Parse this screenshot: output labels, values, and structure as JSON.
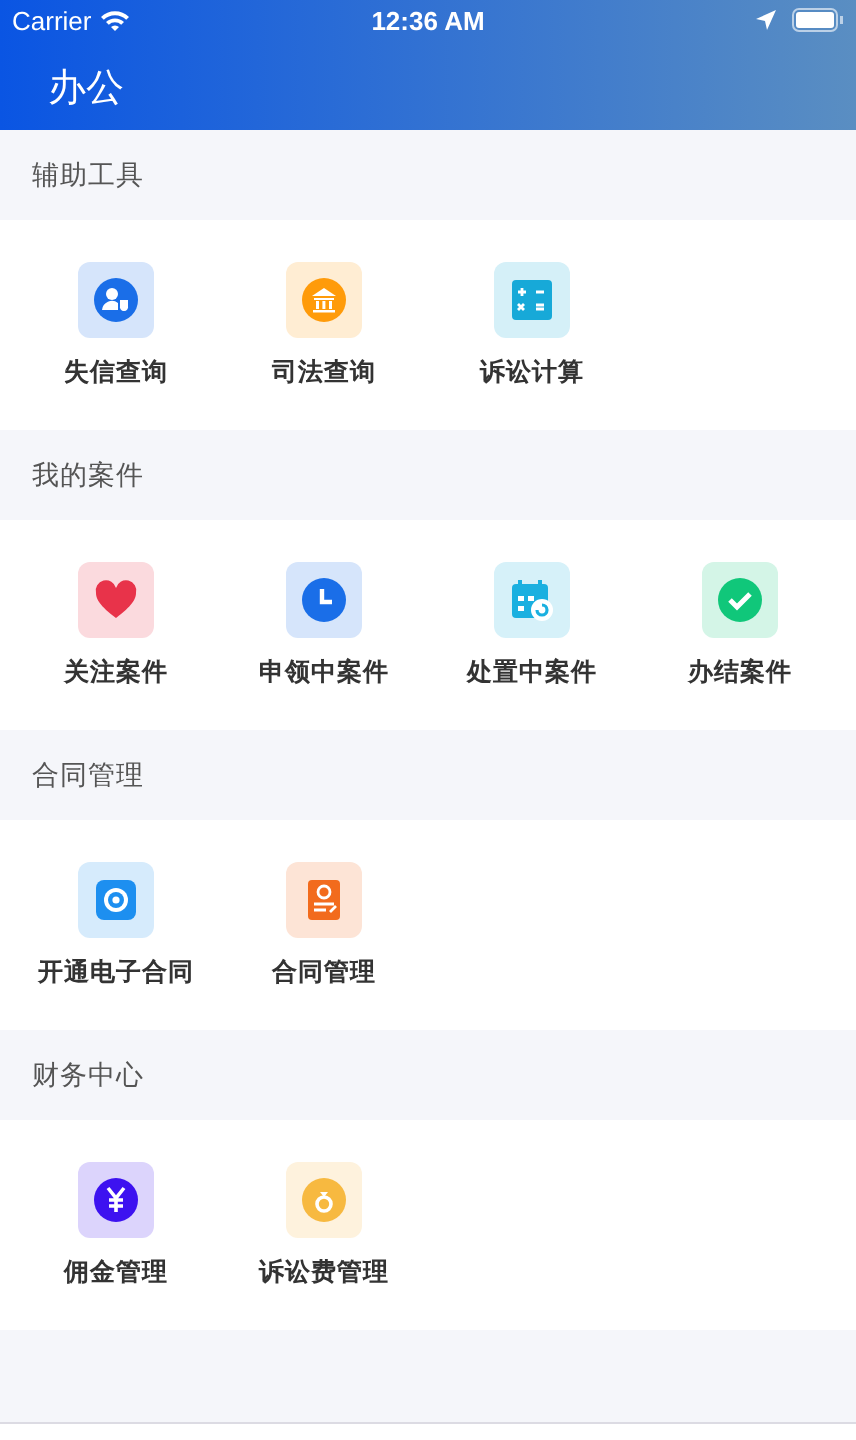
{
  "status_bar": {
    "carrier": "Carrier",
    "time": "12:36 AM"
  },
  "header": {
    "title": "办公"
  },
  "sections": [
    {
      "title": "辅助工具",
      "items": [
        {
          "label": "失信查询",
          "kind": "credit",
          "color": "#1a6ee8"
        },
        {
          "label": "司法查询",
          "kind": "court",
          "color": "#ff9b0a"
        },
        {
          "label": "诉讼计算",
          "kind": "calculator",
          "color": "#17a9d8"
        }
      ]
    },
    {
      "title": "我的案件",
      "items": [
        {
          "label": "关注案件",
          "kind": "heart",
          "color": "#e8334a"
        },
        {
          "label": "申领中案件",
          "kind": "clock",
          "color": "#1a6ee8"
        },
        {
          "label": "处置中案件",
          "kind": "calendar",
          "color": "#1ab0e0"
        },
        {
          "label": "办结案件",
          "kind": "check",
          "color": "#10c77a"
        }
      ]
    },
    {
      "title": "合同管理",
      "items": [
        {
          "label": "开通电子合同",
          "kind": "contract",
          "color": "#1d8ff0"
        },
        {
          "label": "合同管理",
          "kind": "document",
          "color": "#f26b1d"
        }
      ]
    },
    {
      "title": "财务中心",
      "items": [
        {
          "label": "佣金管理",
          "kind": "yen",
          "color": "#3d12f0"
        },
        {
          "label": "诉讼费管理",
          "kind": "bag",
          "color": "#f7b940"
        }
      ]
    }
  ]
}
